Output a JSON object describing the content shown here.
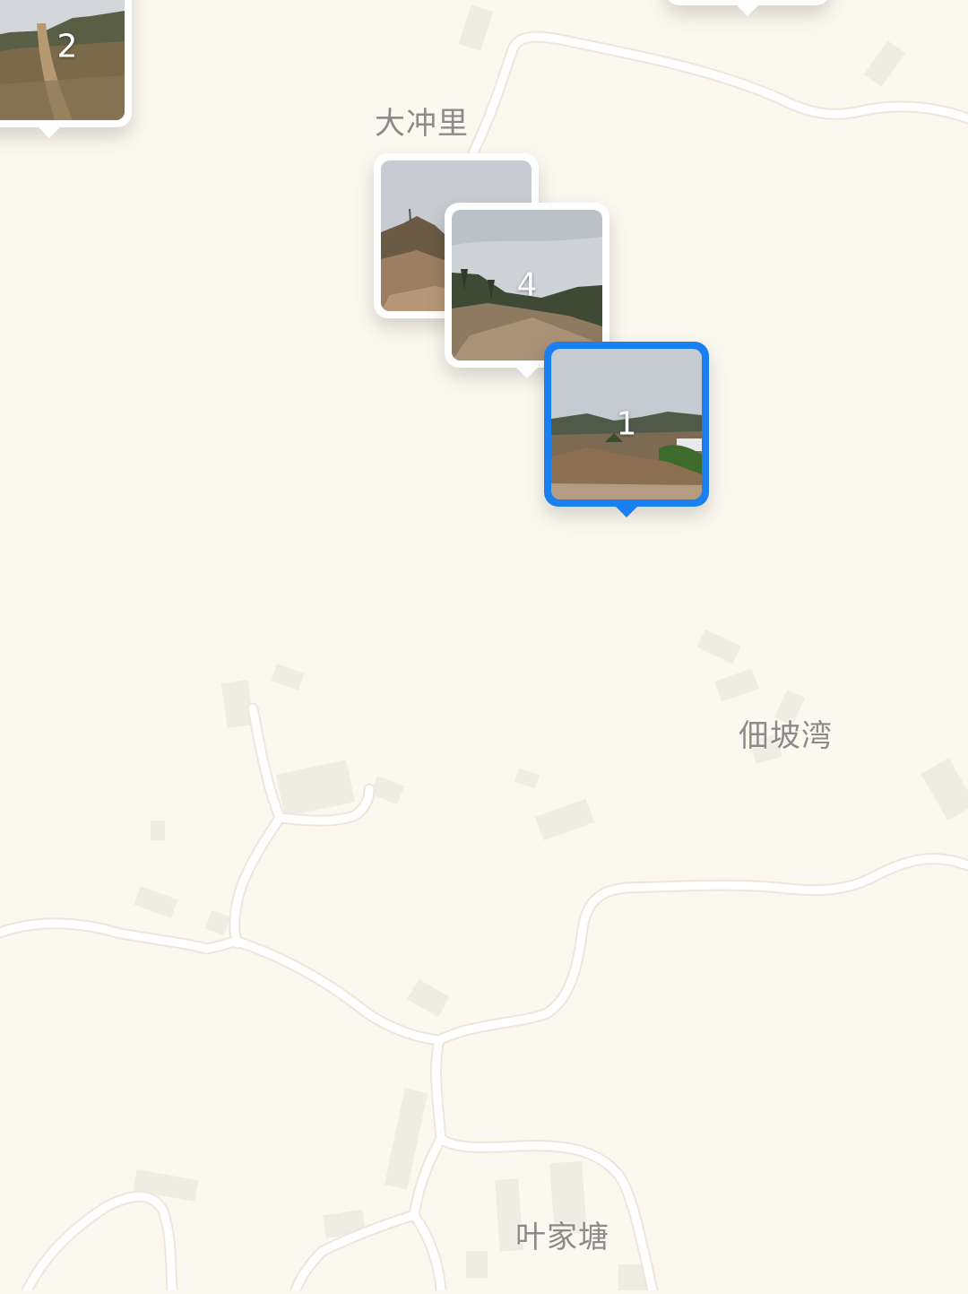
{
  "place_labels": {
    "dachongli": "大冲里",
    "dianpowan": "佃坡湾",
    "yejiatang": "叶家塘"
  },
  "markers": {
    "top_left": {
      "count": "2",
      "selected": false
    },
    "stack_back": {
      "count": "",
      "selected": false
    },
    "stack_front": {
      "count": "4",
      "selected": false
    },
    "selected": {
      "count": "1",
      "selected": true
    }
  },
  "colors": {
    "map_background": "#fbf8ef",
    "road": "#ffffff",
    "building": "#efece4",
    "label": "#8b8b8b",
    "selected_accent": "#1a7ff0"
  },
  "icons": {
    "photo_thumbnail": "landscape-photo-icon"
  }
}
